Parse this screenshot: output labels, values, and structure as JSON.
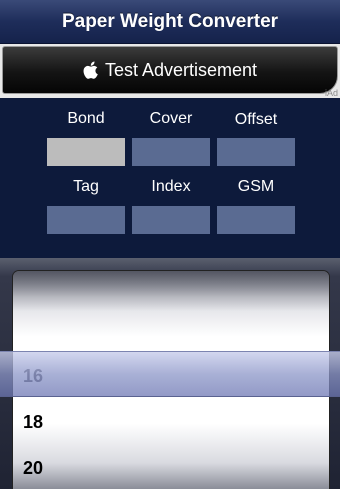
{
  "header": {
    "title": "Paper Weight Converter"
  },
  "ad": {
    "text": "Test Advertisement",
    "tag": "iAd",
    "icon": "apple-logo-icon"
  },
  "fields": [
    {
      "label": "Bond",
      "value": "",
      "selected": true
    },
    {
      "label": "Cover",
      "value": "",
      "selected": false
    },
    {
      "label": "Offset",
      "value": "",
      "selected": false
    },
    {
      "label": "Tag",
      "value": "",
      "selected": false
    },
    {
      "label": "Index",
      "value": "",
      "selected": false
    },
    {
      "label": "GSM",
      "value": "",
      "selected": false
    }
  ],
  "picker": {
    "rows": [
      "16",
      "18",
      "20"
    ],
    "selected_value": "16"
  },
  "colors": {
    "background": "#0d1a3b",
    "field_box": "#5a6b92",
    "field_box_selected": "#bcbcbc"
  }
}
